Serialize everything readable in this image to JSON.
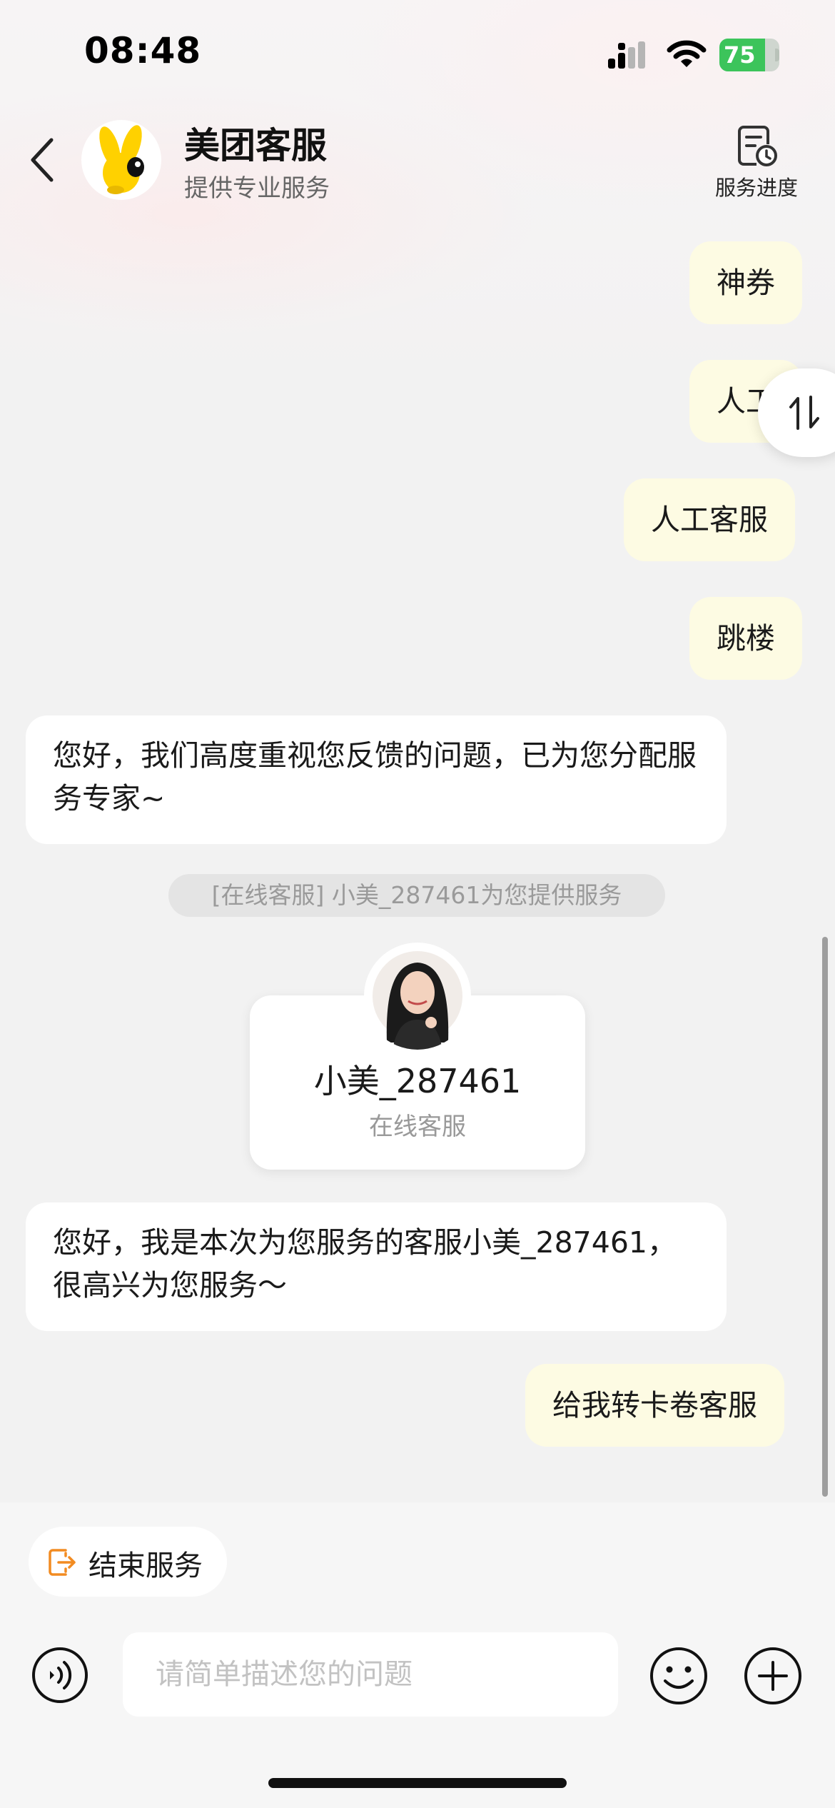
{
  "status_bar": {
    "time": "08:48",
    "battery_level": "75"
  },
  "header": {
    "title": "美团客服",
    "subtitle": "提供专业服务",
    "progress_label": "服务进度"
  },
  "messages": {
    "user_1": "神券",
    "user_2": "人工",
    "user_3": "人工客服",
    "user_4": "跳楼",
    "bot_1": "您好，我们高度重视您反馈的问题，已为您分配服务专家~",
    "system_note": "[在线客服] 小美_287461为您提供服务",
    "bot_2": "您好，我是本次为您服务的客服小美_287461，很高兴为您服务～",
    "user_5": "给我转卡卷客服"
  },
  "agent_card": {
    "name": "小美_287461",
    "role": "在线客服"
  },
  "bottom": {
    "end_service_label": "结束服务",
    "input_placeholder": "请简单描述您的问题"
  },
  "colors": {
    "user_bubble": "#fdfbe3",
    "bot_bubble": "#ffffff",
    "accent_orange": "#f28b21",
    "battery_green": "#3cc45b",
    "logo_yellow": "#ffd100"
  },
  "icons": {
    "back": "chevron-left-icon",
    "progress": "document-clock-icon",
    "scroll_toggle": "swap-vertical-icon",
    "end_service": "exit-icon",
    "voice": "voice-icon",
    "emoji": "smiley-icon",
    "plus": "plus-circle-icon"
  }
}
